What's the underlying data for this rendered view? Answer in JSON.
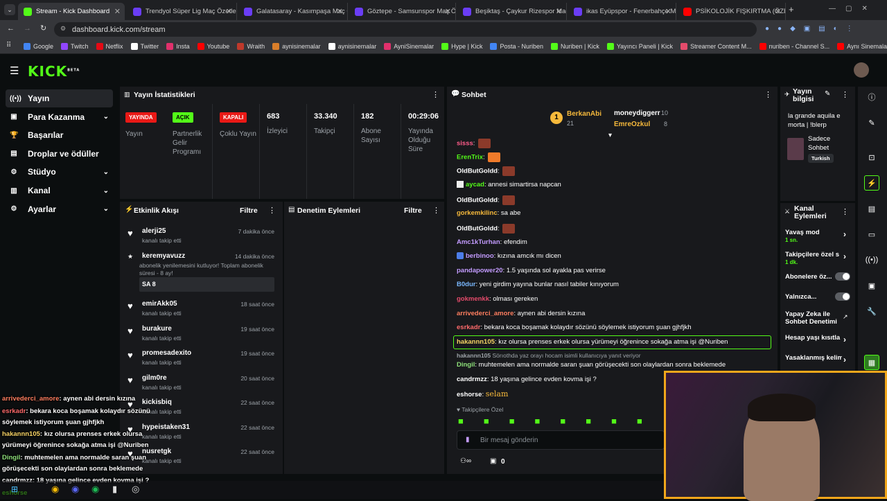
{
  "browser": {
    "tabs": [
      "Stream - Kick Dashboard",
      "Trendyol Süper Lig Maç Özetleri",
      "Galatasaray - Kasımpaşa Maç Ö",
      "Göztepe - Samsunspor Maç Öz",
      "Beşiktaş - Çaykur Rizespor Maç",
      "ikas Eyüpspor - Fenerbahçe Ma",
      "PSİKOLOJİK FIŞKIRTMA (ÖZET_"
    ],
    "url": "dashboard.kick.com/stream",
    "bookmarks": [
      "Google",
      "Twitch",
      "Netflix",
      "Twitter",
      "Insta",
      "Youtube",
      "Wraith",
      "aynisinemalar",
      "aynisinemalar",
      "AyniSinemalar",
      "Hype | Kick",
      "Posta - Nuriben",
      "Nuriben | Kick",
      "Yayıncı Paneli | Kick",
      "Streamer Content M...",
      "nuriben - Channel S...",
      "Aynı Sinemalar - Ça..."
    ]
  },
  "brand": {
    "logo": "KICK",
    "beta": "BETA",
    "accent": "#53fc18"
  },
  "sidebar": {
    "items": [
      {
        "label": "Yayın",
        "icon": "broadcast-icon"
      },
      {
        "label": "Para Kazanma",
        "icon": "wallet-icon"
      },
      {
        "label": "Başarılar",
        "icon": "trophy-icon"
      },
      {
        "label": "Droplar ve ödüller",
        "icon": "gift-icon"
      },
      {
        "label": "Stüdyo",
        "icon": "gear-icon"
      },
      {
        "label": "Kanal",
        "icon": "chart-icon"
      },
      {
        "label": "Ayarlar",
        "icon": "gear-icon"
      }
    ]
  },
  "stats": {
    "title": "Yayın İstatistikleri",
    "tags": [
      {
        "tag": "YAYINDA",
        "label": "Yayın"
      },
      {
        "tag": "AÇIK",
        "label": "Partnerlik Gelir Programı"
      },
      {
        "tag": "KAPALI",
        "label": "Çoklu Yayın"
      }
    ],
    "values": [
      {
        "value": "683",
        "label": "İzleyici"
      },
      {
        "value": "33.340",
        "label": "Takipçi"
      },
      {
        "value": "182",
        "label": "Abone Sayısı"
      },
      {
        "value": "00:29:06",
        "label": "Yayında Olduğu Süre"
      }
    ]
  },
  "feed": {
    "title": "Etkinlik Akışı",
    "filter": "Filtre",
    "items": [
      {
        "name": "alerji25",
        "sub": "kanalı takip etti",
        "time": "7 dakika önce"
      },
      {
        "name": "keremyavuzz",
        "sub": "abonelik yenilemesini kutluyor! Toplam abonelik süresi - 8 ay!",
        "time": "14 dakika önce",
        "msg": "SA 8"
      },
      {
        "name": "emirAkk05",
        "sub": "kanalı takip etti",
        "time": "18 saat önce"
      },
      {
        "name": "burakure",
        "sub": "kanalı takip etti",
        "time": "19 saat önce"
      },
      {
        "name": "promesadexito",
        "sub": "kanalı takip etti",
        "time": "19 saat önce"
      },
      {
        "name": "gilm0re",
        "sub": "kanalı takip etti",
        "time": "20 saat önce"
      },
      {
        "name": "kickisbiq",
        "sub": "kanalı takip etti",
        "time": "22 saat önce"
      },
      {
        "name": "hypeistaken31",
        "sub": "kanalı takip etti",
        "time": "22 saat önce"
      },
      {
        "name": "nusretgk",
        "sub": "kanalı takip etti",
        "time": "22 saat önce"
      }
    ]
  },
  "moderation": {
    "title": "Denetim Eylemleri",
    "filter": "Filtre"
  },
  "chat": {
    "title": "Sohbet",
    "leader": {
      "rank": "1",
      "name": "BerkanAbi",
      "count": "21",
      "second": "moneydiggerr",
      "second_count": "10",
      "third": "EmreOzkul",
      "third_count": "8"
    },
    "messages": [
      {
        "user": "sisss",
        "text": "",
        "color": "#ff5c8a"
      },
      {
        "user": "ErenTrix",
        "text": "",
        "color": "#53fc18"
      },
      {
        "user": "OldButGoldd",
        "text": "",
        "color": "#ffffff"
      },
      {
        "user": "aycad",
        "text": "annesi simartirsa napcan",
        "color": "#53fc18"
      },
      {
        "user": "OldButGoldd",
        "text": "",
        "color": "#ffffff"
      },
      {
        "user": "gorkemkilinc",
        "text": "sa abe",
        "color": "#f6b93b"
      },
      {
        "user": "OldButGoldd",
        "text": "",
        "color": "#ffffff"
      },
      {
        "user": "Amc1kTurhan",
        "text": "efendim",
        "color": "#c39bff"
      },
      {
        "user": "berbinoo",
        "text": "kızına amcık mı dicen",
        "color": "#c39bff"
      },
      {
        "user": "pandapower20",
        "text": "1.5 yaşında sol ayakla pas verirse",
        "color": "#c39bff"
      },
      {
        "user": "B0dur",
        "text": "yeni girdim yayına bunlar nasıl tabiler kınıyorum",
        "color": "#7ab8ff"
      },
      {
        "user": "gokmenkk",
        "text": "olması gereken",
        "color": "#e54b6b"
      },
      {
        "user": "arrivederci_amore",
        "text": "aynen abi dersin kızına",
        "color": "#ff7e5f"
      },
      {
        "user": "esrkadr",
        "text": "bekara koca boşamak kolaydır sözünü söylemek istiyorum şuan gjhfjkh",
        "color": "#ff6b6b"
      },
      {
        "user": "hakannn105",
        "text": "kız olursa prenses erkek olursa yürümeyi öğrenince sokağa atma işi @Nuriben",
        "color": "#f6d365"
      },
      {
        "user": "hakannn105",
        "text": "Sörıothda yaz orayı hocam isimli kullanıcıya yanıt veriyor",
        "color": "#9da3a9"
      },
      {
        "user": "Dingil",
        "text": "muhtemelen ama normalde saran şuan görüşecekti son olaylardan sonra beklemede",
        "color": "#8ee07a"
      },
      {
        "user": "candrmzz",
        "text": "18 yaşına gelince evden kovma işi ?",
        "color": "#ffffff"
      },
      {
        "user": "eshorse",
        "text": "selam",
        "color": "#ffffff"
      }
    ],
    "followers_only": "Takipçilere Özel",
    "placeholder": "Bir mesaj gönderin",
    "counter": "0"
  },
  "info": {
    "title": "Yayın bilgisi",
    "stream_title": "la grande aquila e morta | !blerp",
    "category": "Sadece Sohbet",
    "language": "Turkish"
  },
  "actions": {
    "title": "Kanal Eylemleri",
    "items": [
      {
        "label": "Yavaş mod",
        "sub": "1 sn."
      },
      {
        "label": "Takipçilere özel s",
        "sub": "1 dk."
      },
      {
        "label": "Abonelere öz..."
      },
      {
        "label": "Yalnızca..."
      },
      {
        "label": "Yapay Zeka ile Sohbet Denetimi"
      },
      {
        "label": "Hesap yaşı kısıtla"
      },
      {
        "label": "Yasaklanmış kelim"
      }
    ]
  },
  "overlay": [
    {
      "user": "arrivederci_amore",
      "text": ": aynen abi dersin kızına",
      "color": "#ff7e5f"
    },
    {
      "user": "esrkadr",
      "text": ": bekara koca boşamak kolaydır sözünü söylemek istiyorum şuan gjhfjkh",
      "color": "#ff6b6b"
    },
    {
      "user": "hakannn105",
      "text": ": kız olursa prenses erkek olursa yürümeyi öğrenince sokağa atma işi @Nuriben",
      "color": "#f6d365"
    },
    {
      "user": "Dingil",
      "text": ": muhtemelen ama normalde saran şuan görüşecekti son olaylardan sonra beklemede",
      "color": "#8ee07a"
    },
    {
      "user": "candrmzz",
      "text": ": 18 yaşına gelince evden kovma işi ?",
      "color": "#ffffff"
    },
    {
      "user": "eshorse",
      "text": "",
      "color": "#53fc18"
    }
  ]
}
